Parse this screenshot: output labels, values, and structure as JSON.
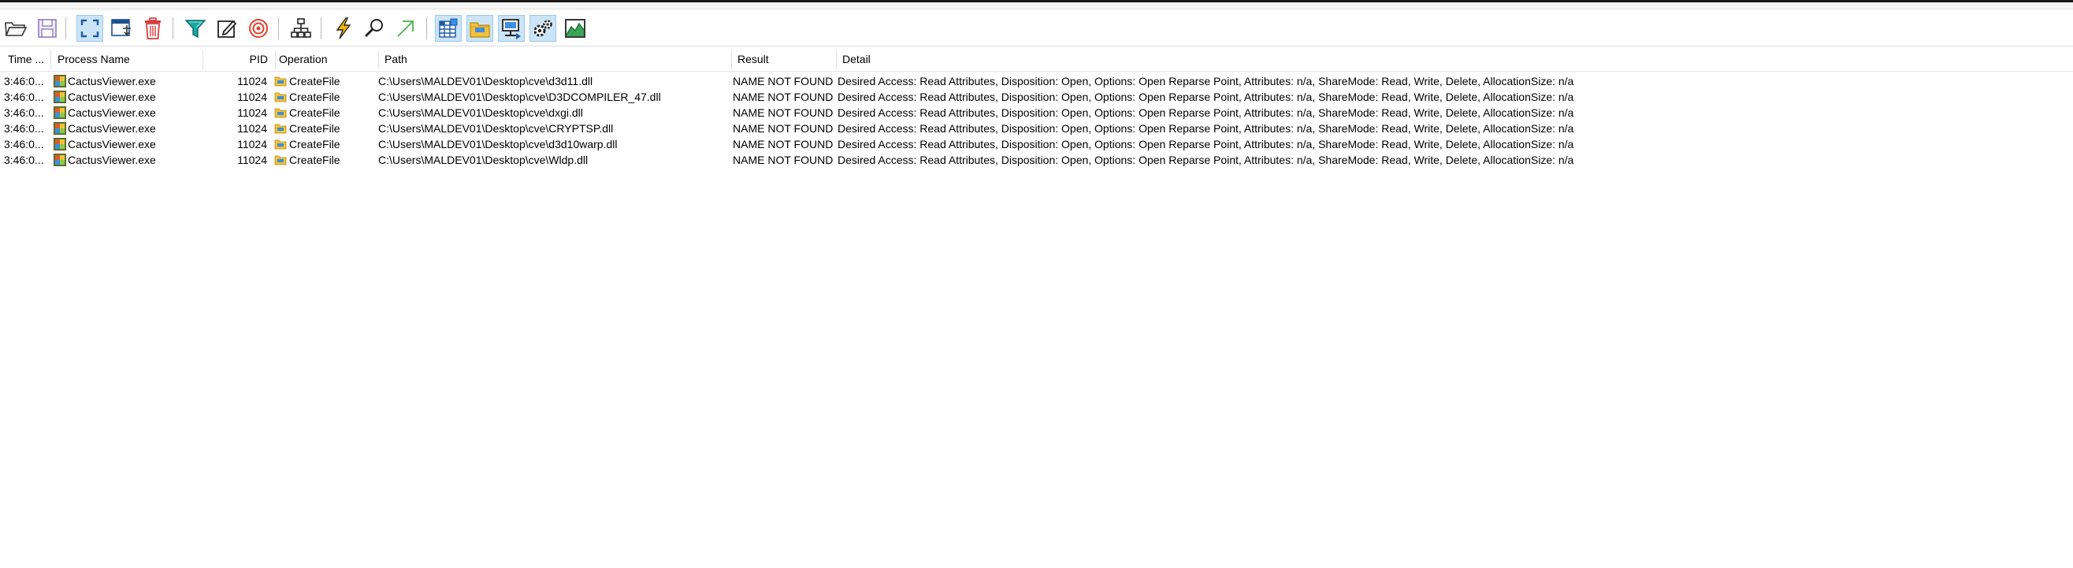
{
  "columns": {
    "time": "Time ...",
    "process": "Process Name",
    "pid": "PID",
    "operation": "Operation",
    "path": "Path",
    "result": "Result",
    "detail": "Detail"
  },
  "rows": [
    {
      "time": "3:46:0...",
      "process": "CactusViewer.exe",
      "pid": "11024",
      "operation": "CreateFile",
      "path": "C:\\Users\\MALDEV01\\Desktop\\cve\\d3d11.dll",
      "result": "NAME NOT FOUND",
      "detail": "Desired Access: Read Attributes, Disposition: Open, Options: Open Reparse Point, Attributes: n/a, ShareMode: Read, Write, Delete, AllocationSize: n/a"
    },
    {
      "time": "3:46:0...",
      "process": "CactusViewer.exe",
      "pid": "11024",
      "operation": "CreateFile",
      "path": "C:\\Users\\MALDEV01\\Desktop\\cve\\D3DCOMPILER_47.dll",
      "result": "NAME NOT FOUND",
      "detail": "Desired Access: Read Attributes, Disposition: Open, Options: Open Reparse Point, Attributes: n/a, ShareMode: Read, Write, Delete, AllocationSize: n/a"
    },
    {
      "time": "3:46:0...",
      "process": "CactusViewer.exe",
      "pid": "11024",
      "operation": "CreateFile",
      "path": "C:\\Users\\MALDEV01\\Desktop\\cve\\dxgi.dll",
      "result": "NAME NOT FOUND",
      "detail": "Desired Access: Read Attributes, Disposition: Open, Options: Open Reparse Point, Attributes: n/a, ShareMode: Read, Write, Delete, AllocationSize: n/a"
    },
    {
      "time": "3:46:0...",
      "process": "CactusViewer.exe",
      "pid": "11024",
      "operation": "CreateFile",
      "path": "C:\\Users\\MALDEV01\\Desktop\\cve\\CRYPTSP.dll",
      "result": "NAME NOT FOUND",
      "detail": "Desired Access: Read Attributes, Disposition: Open, Options: Open Reparse Point, Attributes: n/a, ShareMode: Read, Write, Delete, AllocationSize: n/a"
    },
    {
      "time": "3:46:0...",
      "process": "CactusViewer.exe",
      "pid": "11024",
      "operation": "CreateFile",
      "path": "C:\\Users\\MALDEV01\\Desktop\\cve\\d3d10warp.dll",
      "result": "NAME NOT FOUND",
      "detail": "Desired Access: Read Attributes, Disposition: Open, Options: Open Reparse Point, Attributes: n/a, ShareMode: Read, Write, Delete, AllocationSize: n/a"
    },
    {
      "time": "3:46:0...",
      "process": "CactusViewer.exe",
      "pid": "11024",
      "operation": "CreateFile",
      "path": "C:\\Users\\MALDEV01\\Desktop\\cve\\Wldp.dll",
      "result": "NAME NOT FOUND",
      "detail": "Desired Access: Read Attributes, Disposition: Open, Options: Open Reparse Point, Attributes: n/a, ShareMode: Read, Write, Delete, AllocationSize: n/a"
    }
  ],
  "toolbar": {
    "buttons": [
      {
        "icon": "open-folder-icon",
        "active": false
      },
      {
        "icon": "save-icon",
        "active": false
      },
      {
        "icon": "capture-icon",
        "active": true
      },
      {
        "icon": "autoscroll-icon",
        "active": false
      },
      {
        "icon": "clear-icon",
        "active": false
      },
      {
        "icon": "filter-icon",
        "active": false
      },
      {
        "icon": "highlight-icon",
        "active": false
      },
      {
        "icon": "target-icon",
        "active": false
      },
      {
        "icon": "process-tree-icon",
        "active": false
      },
      {
        "icon": "event-properties-icon",
        "active": false
      },
      {
        "icon": "find-icon",
        "active": false
      },
      {
        "icon": "jump-to-icon",
        "active": false
      },
      {
        "icon": "registry-activity-icon",
        "active": true
      },
      {
        "icon": "file-activity-icon",
        "active": true
      },
      {
        "icon": "network-activity-icon",
        "active": true
      },
      {
        "icon": "process-activity-icon",
        "active": true
      },
      {
        "icon": "profiling-icon",
        "active": false
      }
    ]
  },
  "colors": {
    "toggle_on_bg": "#cce4f7",
    "toggle_on_border": "#99c9ef",
    "clear_red": "#d83b3b",
    "filter_teal": "#1aa7a1",
    "target_red": "#e0402f",
    "lightning_yellow": "#f2b705",
    "jump_green": "#5cb85c"
  }
}
